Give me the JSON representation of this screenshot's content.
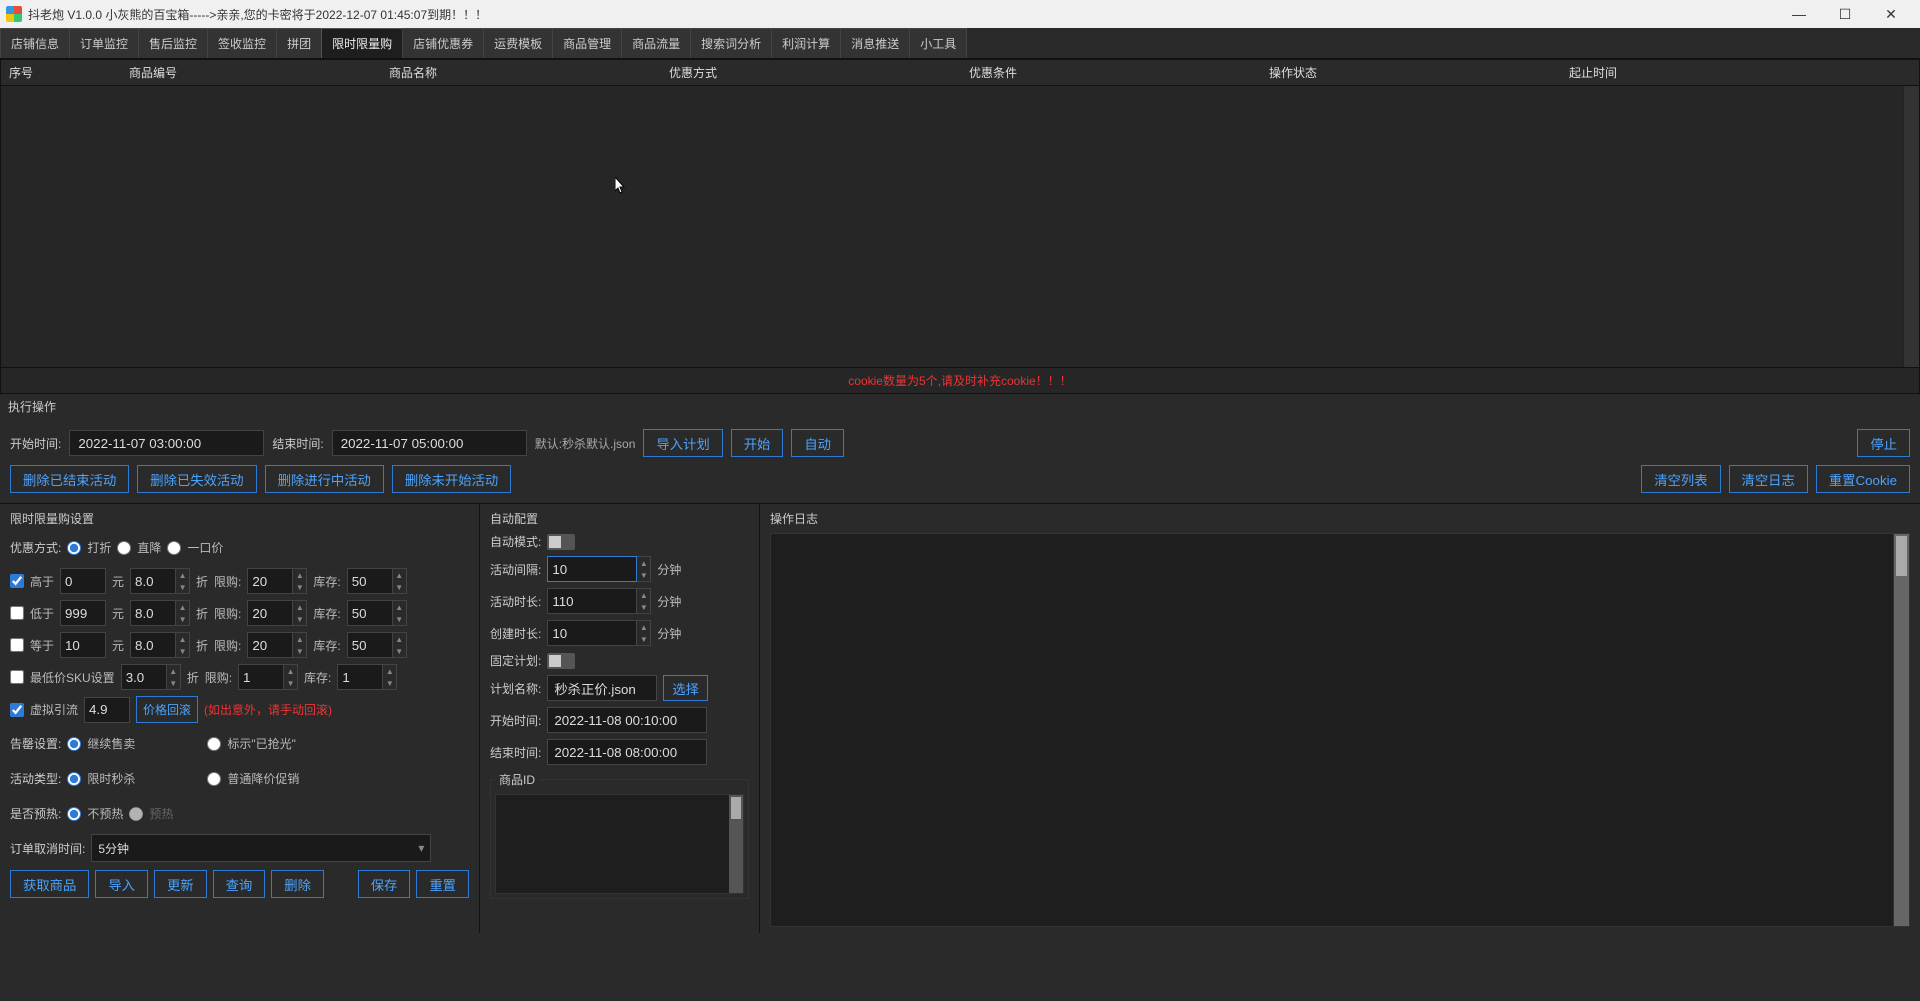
{
  "titlebar": {
    "title": "抖老炮 V1.0.0    小灰熊的百宝箱----->亲亲,您的卡密将于2022-12-07 01:45:07到期！！！"
  },
  "tabs": [
    "店铺信息",
    "订单监控",
    "售后监控",
    "签收监控",
    "拼团",
    "限时限量购",
    "店铺优惠券",
    "运费模板",
    "商品管理",
    "商品流量",
    "搜索词分析",
    "利润计算",
    "消息推送",
    "小工具"
  ],
  "active_tab_index": 5,
  "grid_columns": [
    "序号",
    "商品编号",
    "商品名称",
    "优惠方式",
    "优惠条件",
    "操作状态",
    "起止时间"
  ],
  "grid_footer_warning": "cookie数量为5个,请及时补充cookie！！！",
  "exec": {
    "section": "执行操作",
    "start_label": "开始时间:",
    "start_value": "2022-11-07 03:00:00",
    "end_label": "结束时间:",
    "end_value": "2022-11-07 05:00:00",
    "default_json": "默认:秒杀默认.json",
    "btn_import": "导入计划",
    "btn_start": "开始",
    "btn_auto": "自动",
    "btn_stop": "停止",
    "btn_del_end": "删除已结束活动",
    "btn_del_invalid": "删除已失效活动",
    "btn_del_running": "删除进行中活动",
    "btn_del_notstart": "删除未开始活动",
    "btn_clear_list": "清空列表",
    "btn_clear_log": "清空日志",
    "btn_reset_cookie": "重置Cookie"
  },
  "settings": {
    "title": "限时限量购设置",
    "discount_label": "优惠方式:",
    "discount_options": [
      "打折",
      "直降",
      "一口价"
    ],
    "rows": {
      "gt": {
        "label": "高于",
        "price": "0",
        "unit": "元",
        "discount": "8.0",
        "dunit": "折",
        "limit_label": "限购:",
        "limit": "20",
        "stock_label": "库存:",
        "stock": "50"
      },
      "lt": {
        "label": "低于",
        "price": "999",
        "unit": "元",
        "discount": "8.0",
        "dunit": "折",
        "limit_label": "限购:",
        "limit": "20",
        "stock_label": "库存:",
        "stock": "50"
      },
      "eq": {
        "label": "等于",
        "price": "10",
        "unit": "元",
        "discount": "8.0",
        "dunit": "折",
        "limit_label": "限购:",
        "limit": "20",
        "stock_label": "库存:",
        "stock": "50"
      },
      "minsku": {
        "label": "最低价SKU设置",
        "discount": "3.0",
        "dunit": "折",
        "limit_label": "限购:",
        "limit": "1",
        "stock_label": "库存:",
        "stock": "1"
      }
    },
    "virtual": {
      "label": "虚拟引流",
      "value": "4.9",
      "rollback": "价格回滚",
      "warn": "(如出意外，请手动回滚)"
    },
    "soldout": {
      "label": "告罄设置:",
      "opts": [
        "继续售卖",
        "标示\"已抢光\""
      ]
    },
    "acttype": {
      "label": "活动类型:",
      "opts": [
        "限时秒杀",
        "普通降价促销"
      ]
    },
    "preheat": {
      "label": "是否预热:",
      "opts": [
        "不预热",
        "预热"
      ]
    },
    "cancel": {
      "label": "订单取消时间:",
      "value": "5分钟"
    },
    "bottom_btns": [
      "获取商品",
      "导入",
      "更新",
      "查询",
      "删除",
      "保存",
      "重置"
    ]
  },
  "auto": {
    "title": "自动配置",
    "mode_label": "自动模式:",
    "interval": {
      "label": "活动间隔:",
      "value": "10",
      "unit": "分钟"
    },
    "duration": {
      "label": "活动时长:",
      "value": "110",
      "unit": "分钟"
    },
    "create": {
      "label": "创建时长:",
      "value": "10",
      "unit": "分钟"
    },
    "fixed": {
      "label": "固定计划:"
    },
    "plan": {
      "label": "计划名称:",
      "value": "秒杀正价.json",
      "choose": "选择"
    },
    "start": {
      "label": "开始时间:",
      "value": "2022-11-08 00:10:00"
    },
    "end": {
      "label": "结束时间:",
      "value": "2022-11-08 08:00:00"
    },
    "pid_label": "商品ID"
  },
  "log": {
    "title": "操作日志"
  }
}
